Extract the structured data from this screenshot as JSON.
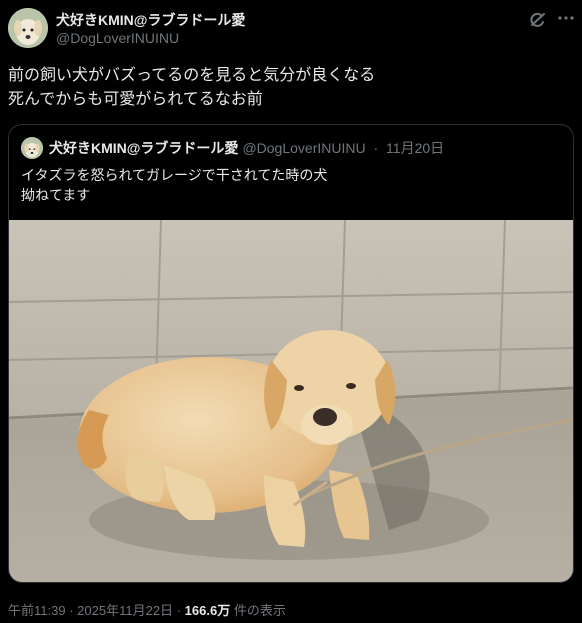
{
  "tweet": {
    "author_name": "犬好きKMIN@ラブラドール愛",
    "author_handle": "@DogLoverINUINU",
    "text_line1": "前の飼い犬がバズってるのを見ると気分が良くなる",
    "text_line2": "死んでからも可愛がられてるなお前",
    "time": "午前11:39",
    "separator": "·",
    "date": "2025年11月22日",
    "views_count": "166.6万",
    "views_label": "件の表示"
  },
  "quote": {
    "author_name": "犬好きKMIN@ラブラドール愛",
    "author_handle": "@DogLoverINUINU",
    "separator": "·",
    "date": "11月20日",
    "text_line1": "イタズラを怒られてガレージで干されてた時の犬",
    "text_line2": "拗ねてます"
  },
  "icons": {
    "grok": "grok-icon",
    "more": "more-icon"
  },
  "colors": {
    "background": "#000000",
    "text_primary": "#e7e9ea",
    "text_secondary": "#71767b",
    "border": "#2f3336"
  }
}
